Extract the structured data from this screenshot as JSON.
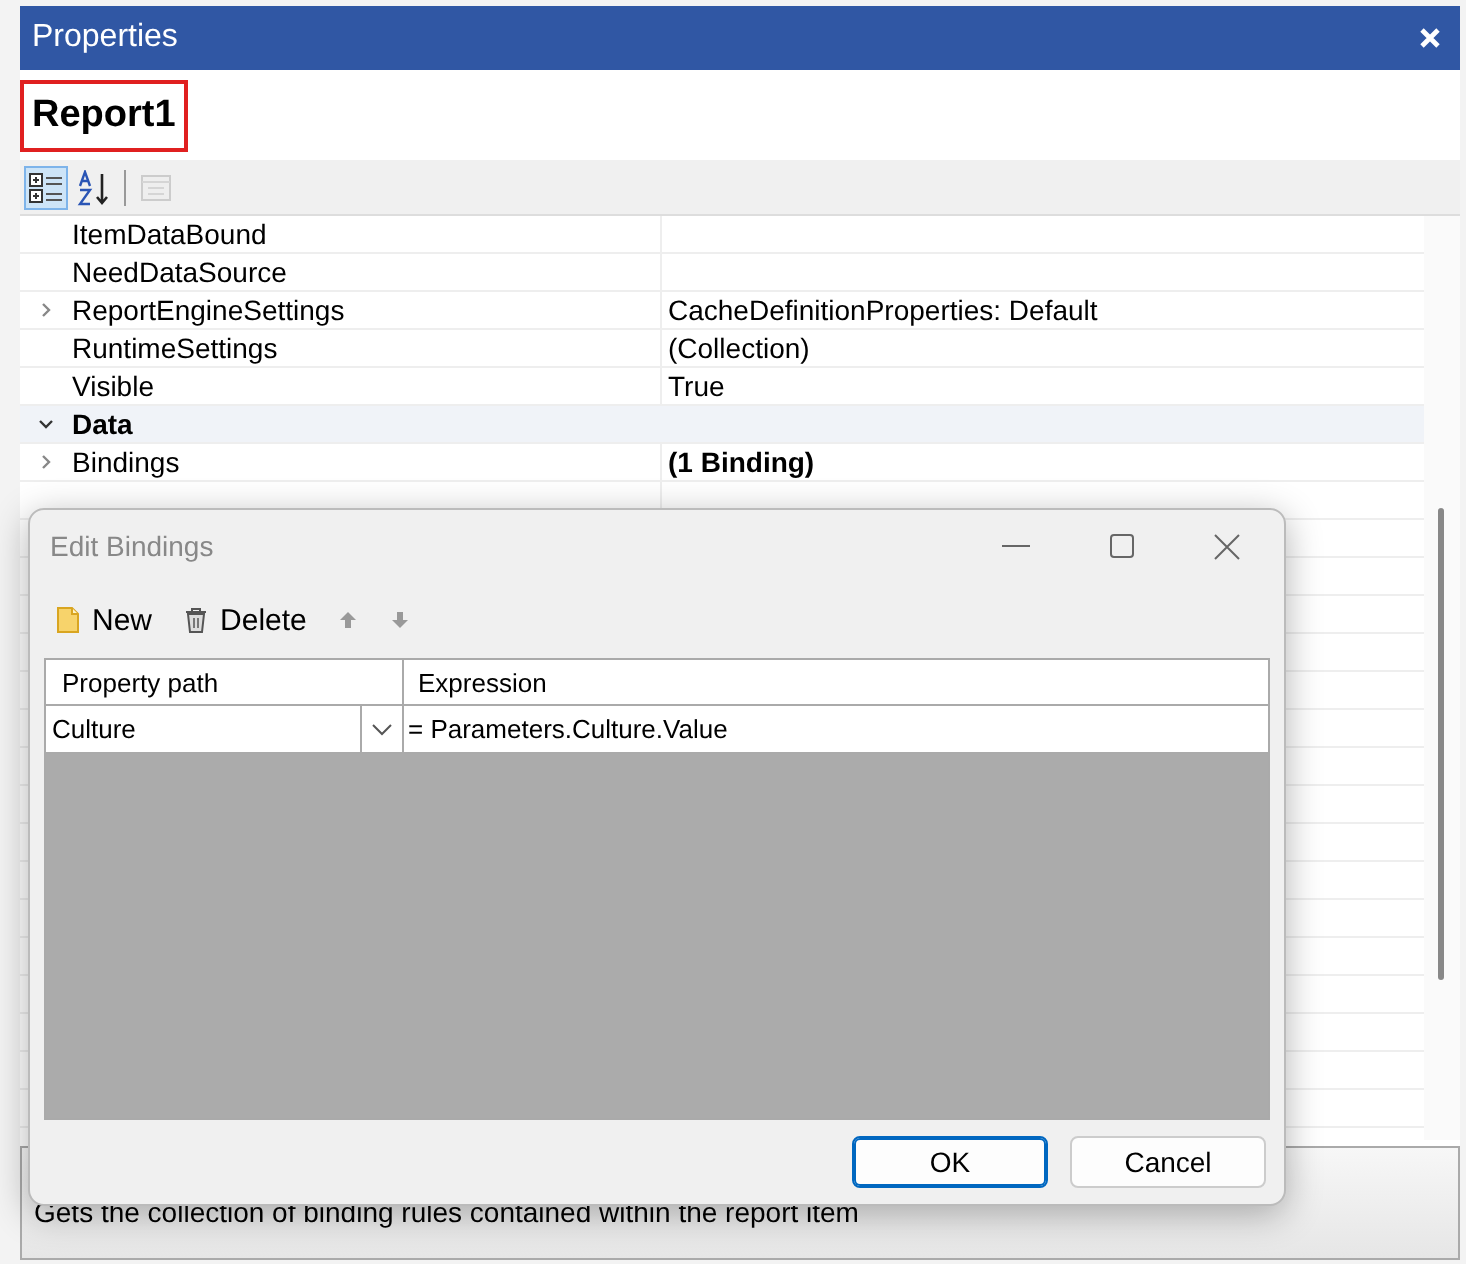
{
  "panel": {
    "title": "Properties",
    "object_name": "Report1",
    "toolbar": [
      {
        "kind": "categorized",
        "selected": true,
        "disabled": false
      },
      {
        "kind": "alphabetical",
        "selected": false,
        "disabled": false
      },
      {
        "kind": "pages",
        "selected": false,
        "disabled": true
      }
    ],
    "rows": [
      {
        "kind": "property",
        "name": "ItemDataBound"
      },
      {
        "kind": "property",
        "name": "NeedDataSource"
      },
      {
        "kind": "property",
        "name": "ReportEngineSettings",
        "value": "CacheDefinitionProperties: Default",
        "expanded": false,
        "bold": false
      },
      {
        "kind": "property",
        "name": "RuntimeSettings",
        "value": "(Collection)",
        "bold": false
      },
      {
        "kind": "property",
        "name": "Visible",
        "value": "True",
        "bold": false
      },
      {
        "kind": "category",
        "name": "Data",
        "expanded": true
      },
      {
        "kind": "property",
        "name": "Bindings",
        "value": "(1 Binding)",
        "expanded": false,
        "bold": true
      }
    ],
    "description": "Gets the collection of binding rules contained within the report item"
  },
  "dialog": {
    "title": "Edit Bindings",
    "toolbar": [
      {
        "kind": "new",
        "label": "New",
        "disabled": false
      },
      {
        "kind": "delete",
        "label": "Delete",
        "disabled": false
      },
      {
        "kind": "up",
        "disabled": true
      },
      {
        "kind": "down",
        "disabled": true
      }
    ],
    "columns": [
      "Property path",
      "Expression"
    ],
    "rows": [
      {
        "property_path": "Culture",
        "expression": "= Parameters.Culture.Value"
      }
    ],
    "buttons": [
      {
        "label": "OK",
        "default": true
      },
      {
        "label": "Cancel",
        "default": false
      }
    ]
  }
}
